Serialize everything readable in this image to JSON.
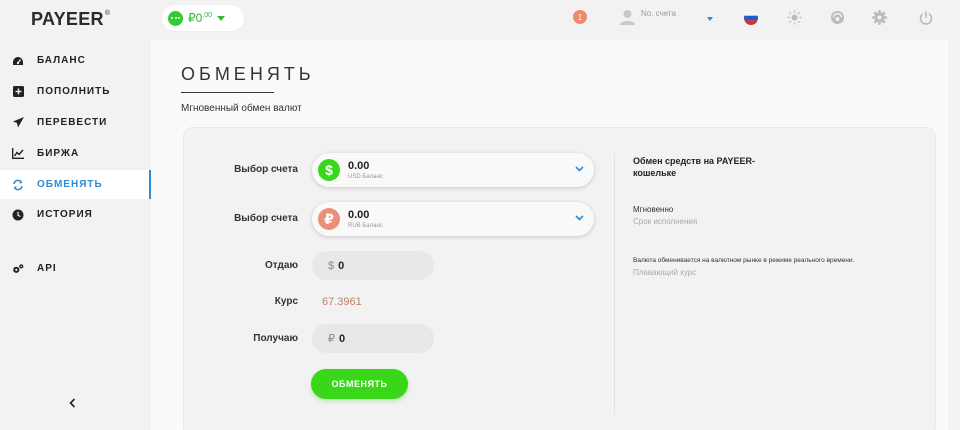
{
  "brand": {
    "logo_text": "PAYEER",
    "logo_mark": "®"
  },
  "sidebar": {
    "items": [
      {
        "label": "БАЛАНС",
        "icon": "gauge-icon"
      },
      {
        "label": "ПОПОЛНИТЬ",
        "icon": "plus-square-icon"
      },
      {
        "label": "ПЕРЕВЕСТИ",
        "icon": "send-icon"
      },
      {
        "label": "БИРЖА",
        "icon": "chart-line-icon"
      },
      {
        "label": "ОБМЕНЯТЬ",
        "icon": "exchange-icon",
        "active": true
      },
      {
        "label": "ИСТОРИЯ",
        "icon": "clock-icon"
      },
      {
        "label": "API",
        "icon": "gears-icon"
      }
    ],
    "collapse_icon": "chevron-left-icon"
  },
  "topbar": {
    "balance_currency": "₽",
    "balance_int": "0",
    "balance_frac": ".00",
    "notification_count": "1",
    "account_placeholder": "No. счета"
  },
  "main": {
    "title": "ОБМЕНЯТЬ",
    "subtitle": "Мгновенный обмен валют",
    "form": {
      "account_label_1": "Выбор счета",
      "account_label_2": "Выбор счета",
      "from_account": {
        "symbol": "$",
        "amount": "0.00",
        "caption": "USD Баланс",
        "color": "#3ad61a"
      },
      "to_account": {
        "symbol": "₽",
        "amount": "0.00",
        "caption": "RUB Баланс",
        "color": "#e9907a"
      },
      "give_label": "Отдаю",
      "give_symbol": "$",
      "give_value": "0",
      "rate_label": "Курс",
      "rate_value": "67.3961",
      "receive_label": "Получаю",
      "receive_symbol": "₽",
      "receive_value": "0",
      "submit_label": "ОБМЕНЯТЬ"
    },
    "info": {
      "title": "Обмен средств на PAYEER-кошельке",
      "speed_value": "Мгновенно",
      "speed_caption": "Срок исполнения",
      "rate_desc": "Валюта обменивается на валютном рынке в режиме реального времени.",
      "rate_caption": "Плавающий курс"
    }
  },
  "colors": {
    "accent": "#2e8bd6",
    "green": "#3ad61a",
    "rate": "#c47e6a"
  }
}
